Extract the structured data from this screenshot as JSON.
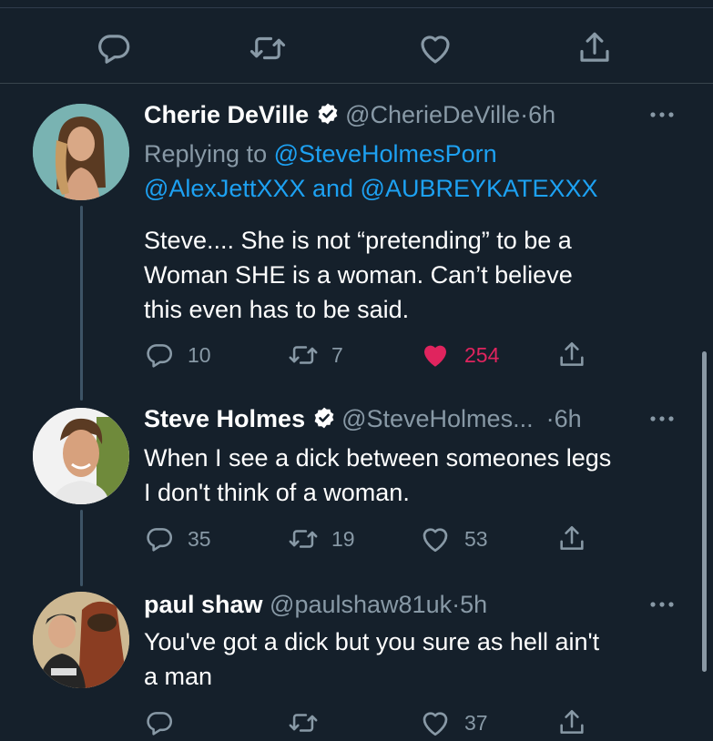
{
  "tweets": [
    {
      "name": "Cherie DeVille",
      "handle": "@CherieDeVille",
      "time": "6h",
      "reply_prefix": "Replying to ",
      "reply_mention_1": "@SteveHolmesPorn",
      "reply_mention_2": "@AlexJettXXX",
      "reply_and": " and ",
      "reply_mention_3": "@AUBREYKATEXXX",
      "text_lines": [
        "Steve.... She is not “pretending” to be a",
        "Woman SHE is a woman.  Can’t believe",
        "this even has to be said."
      ],
      "replies": "10",
      "retweets": "7",
      "likes": "254",
      "liked": true
    },
    {
      "name": "Steve Holmes",
      "handle": "@SteveHolmes...",
      "time": "6h",
      "text_lines": [
        "When I see a dick between someones legs",
        "I don't think of a woman."
      ],
      "replies": "35",
      "retweets": "19",
      "likes": "53",
      "liked": false
    },
    {
      "name": "paul shaw",
      "handle": "@paulshaw81uk",
      "time": "5h",
      "text_lines": [
        "You've got a dick but you sure as hell ain't",
        "a man"
      ],
      "replies": "",
      "retweets": "",
      "likes": "37",
      "liked": false
    }
  ],
  "separator_dot": "·",
  "colors": {
    "background": "#15202b",
    "secondary_text": "#8899a6",
    "link": "#1da1f2",
    "like": "#e0245e"
  },
  "icons": [
    "reply-icon",
    "retweet-icon",
    "like-icon",
    "share-icon",
    "verified-icon",
    "more-icon"
  ]
}
